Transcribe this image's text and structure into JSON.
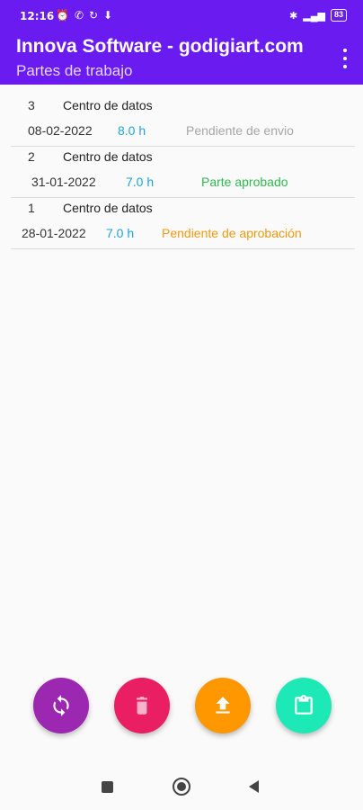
{
  "status_bar": {
    "time": "12:16",
    "battery": "83",
    "left_icons": [
      "alarm-icon",
      "phone-icon",
      "sync-icon",
      "download-icon"
    ],
    "right_icons": [
      "bluetooth-icon",
      "signal-icon",
      "battery-icon"
    ]
  },
  "app_bar": {
    "title": "Innova Software - godigiart.com",
    "subtitle": "Partes de trabajo"
  },
  "rows": [
    {
      "number": "3",
      "name": "Centro de datos",
      "date": "08-02-2022",
      "hours": "8.0 h",
      "status": "Pendiente de envio",
      "status_color": "#a6a6a6"
    },
    {
      "number": "2",
      "name": "Centro de datos",
      "date": "31-01-2022",
      "hours": "7.0 h",
      "status": "Parte aprobado",
      "status_color": "#2fb94e"
    },
    {
      "number": "1",
      "name": "Centro de datos",
      "date": "28-01-2022",
      "hours": "7.0 h",
      "status": "Pendiente de aprobación",
      "status_color": "#f09a0f"
    }
  ],
  "colors": {
    "primary": "#6a1bf0",
    "hours": "#1ea3d6",
    "fab_sync": "#9c27b0",
    "fab_delete": "#e91e63",
    "fab_upload": "#ff9800",
    "fab_clipboard": "#1de9b6"
  },
  "fabs": [
    {
      "name": "sync-fab",
      "icon": "sync-icon"
    },
    {
      "name": "delete-fab",
      "icon": "trash-icon"
    },
    {
      "name": "upload-fab",
      "icon": "upload-icon"
    },
    {
      "name": "clipboard-fab",
      "icon": "clipboard-icon"
    }
  ]
}
